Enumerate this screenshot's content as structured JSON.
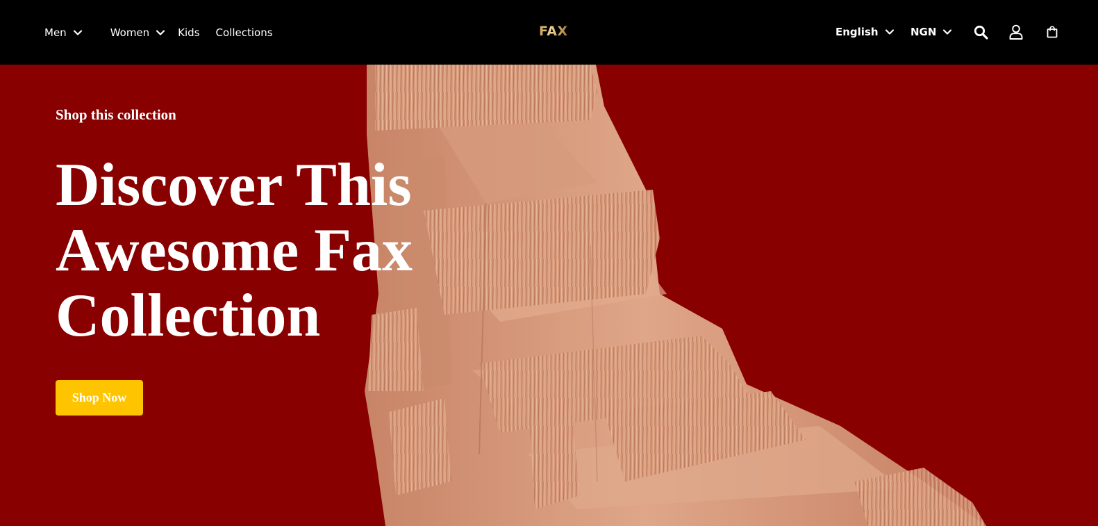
{
  "header": {
    "nav": [
      {
        "label": "Men",
        "has_dropdown": true
      },
      {
        "label": "Women",
        "has_dropdown": true
      },
      {
        "label": "Kids",
        "has_dropdown": false
      },
      {
        "label": "Collections",
        "has_dropdown": false
      }
    ],
    "logo_text": "FAX",
    "language": "English",
    "currency": "NGN",
    "icons": [
      "search-icon",
      "user-icon",
      "shopping-bag-icon"
    ]
  },
  "hero": {
    "eyebrow": "Shop this collection",
    "headline_lines": [
      "Discover This",
      "Awesome Fax",
      "Collection"
    ],
    "cta_label": "Shop Now"
  },
  "colors": {
    "header_bg": "#000000",
    "hero_bg": "#880000",
    "cta_bg": "#ffc400",
    "garment": "#d9a080"
  }
}
